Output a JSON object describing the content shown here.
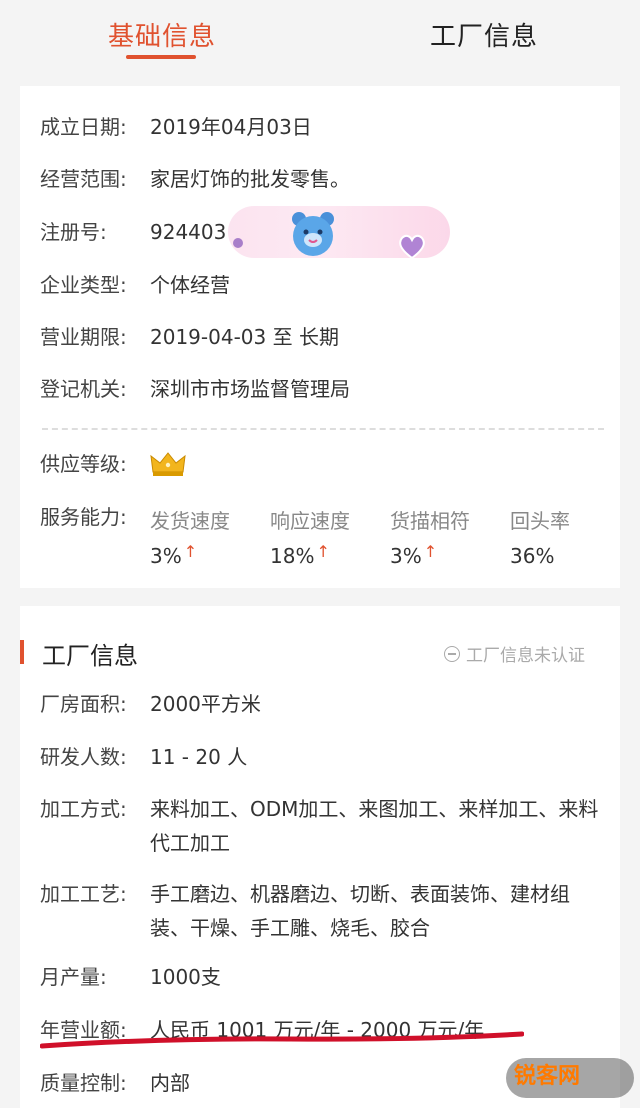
{
  "tabs": {
    "basic": "基础信息",
    "factory": "工厂信息"
  },
  "basic": {
    "found_date_label": "成立日期:",
    "found_date": "2019年04月03日",
    "scope_label": "经营范围:",
    "scope": "家居灯饰的批发零售。",
    "reg_label": "注册号:",
    "reg": "924403",
    "type_label": "企业类型:",
    "type": "个体经营",
    "term_label": "营业期限:",
    "term": "2019-04-03 至 长期",
    "authority_label": "登记机关:",
    "authority": "深圳市市场监督管理局",
    "supply_label": "供应等级:",
    "service_label": "服务能力:",
    "metrics": [
      {
        "name": "发货速度",
        "value": "3%",
        "arrow": "↑"
      },
      {
        "name": "响应速度",
        "value": "18%",
        "arrow": "↑"
      },
      {
        "name": "货描相符",
        "value": "3%",
        "arrow": "↑"
      },
      {
        "name": "回头率",
        "value": "36%",
        "arrow": ""
      }
    ]
  },
  "factory": {
    "title": "工厂信息",
    "status": "工厂信息未认证",
    "area_label": "厂房面积:",
    "area": "2000平方米",
    "rd_label": "研发人数:",
    "rd": "11 - 20 人",
    "method_label": "加工方式:",
    "method": "来料加工、ODM加工、来图加工、来样加工、来料代工加工",
    "process_label": "加工工艺:",
    "process": "手工磨边、机器磨边、切断、表面装饰、建材组装、干燥、手工雕、烧毛、胶合",
    "output_label": "月产量:",
    "output": "1000支",
    "revenue_label": "年营业额:",
    "revenue": "人民币 1001 万元/年 - 2000 万元/年",
    "qc_label": "质量控制:",
    "qc": "内部"
  },
  "watermark": {
    "brand": "锐客网"
  },
  "colors": {
    "accent": "#e0522f",
    "underline": "#d0102a"
  }
}
